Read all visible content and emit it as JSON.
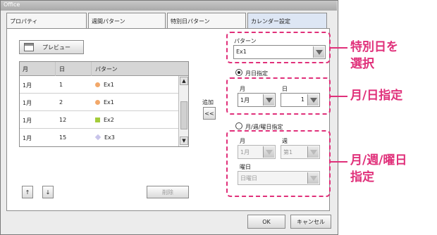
{
  "window": {
    "title": "Office"
  },
  "tabs": [
    {
      "label": "プロパティ",
      "active": false
    },
    {
      "label": "週間パターン",
      "active": false
    },
    {
      "label": "特別日パターン",
      "active": false
    },
    {
      "label": "カレンダー設定",
      "active": true
    }
  ],
  "preview_button": {
    "label": "プレビュー"
  },
  "table": {
    "headers": [
      "月",
      "日",
      "パターン"
    ],
    "rows": [
      {
        "month": "1月",
        "day": "1",
        "pattern": "Ex1",
        "marker": "circle",
        "color": "#f2a86a"
      },
      {
        "month": "1月",
        "day": "2",
        "pattern": "Ex1",
        "marker": "circle",
        "color": "#f2a86a"
      },
      {
        "month": "1月",
        "day": "12",
        "pattern": "Ex2",
        "marker": "square",
        "color": "#a4cc3a"
      },
      {
        "month": "1月",
        "day": "15",
        "pattern": "Ex3",
        "marker": "diamond",
        "color": "#c8c4ea"
      }
    ]
  },
  "add": {
    "label": "追加",
    "button": "<<"
  },
  "bottom": {
    "up": "↑",
    "down": "↓",
    "delete_label": "削除"
  },
  "pattern": {
    "label": "パターン",
    "value": "Ex1"
  },
  "monthday": {
    "label": "月日指定",
    "selected": true,
    "month_label": "月",
    "month_value": "1月",
    "day_label": "日",
    "day_value": "1"
  },
  "monthweek": {
    "label": "月/週/曜日指定",
    "selected": false,
    "month_label": "月",
    "month_value": "1月",
    "week_label": "週",
    "week_value": "第1",
    "weekday_label": "曜日",
    "weekday_value": "日曜日"
  },
  "footer": {
    "ok": "OK",
    "cancel": "キャンセル"
  },
  "callouts": {
    "pattern": "特別日を\n選択",
    "monthday": "月/日指定",
    "monthweek": "月/週/曜日\n指定"
  },
  "colors": {
    "highlight": "#e0307a",
    "active_tab": "#dde6f4"
  }
}
